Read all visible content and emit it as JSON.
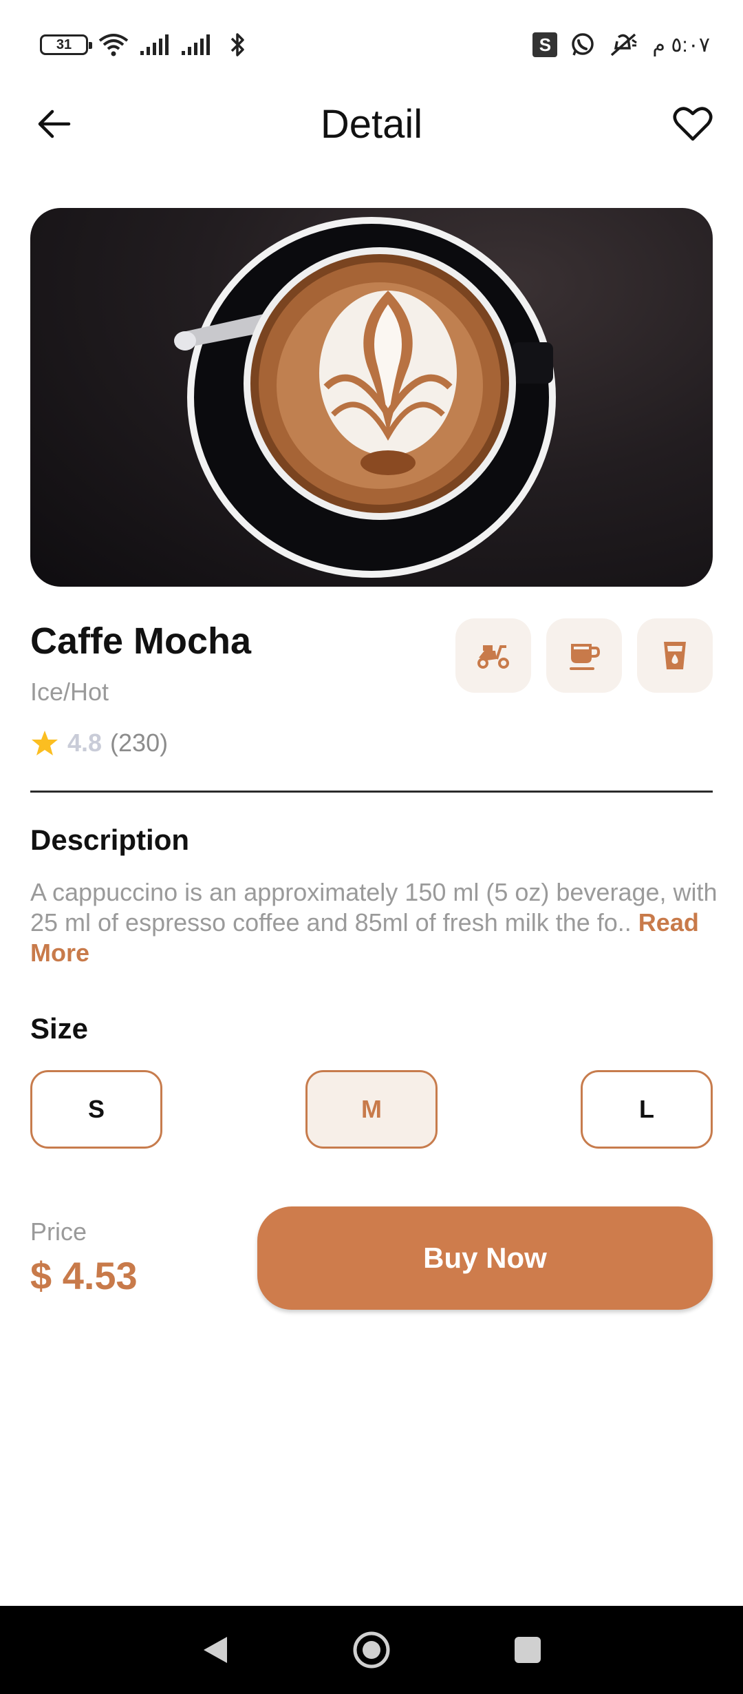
{
  "status_bar": {
    "battery_level": "31",
    "time": "٥:٠٧ م",
    "icons": [
      "wifi-icon",
      "signal-icon",
      "signal-icon",
      "bluetooth-icon",
      "s-app-icon",
      "whatsapp-icon",
      "muted-icon"
    ],
    "s_app_letter": "S"
  },
  "app_bar": {
    "title": "Detail",
    "back_icon": "arrow-left-icon",
    "favorite_icon": "heart-outline-icon"
  },
  "product": {
    "name": "Caffe Mocha",
    "subtitle": "Ice/Hot",
    "rating": "4.8",
    "reviews": "(230)",
    "features": [
      "delivery-scooter-icon",
      "coffee-cup-icon",
      "milk-glass-icon"
    ]
  },
  "description": {
    "title": "Description",
    "text": "A cappuccino is an approximately 150 ml (5 oz) beverage, with 25 ml of espresso coffee and 85ml of fresh milk the fo..",
    "read_more": "Read More"
  },
  "size": {
    "title": "Size",
    "options": [
      "S",
      "M",
      "L"
    ],
    "selected": "M"
  },
  "checkout": {
    "price_label": "Price",
    "price": "$ 4.53",
    "buy_label": "Buy Now"
  },
  "colors": {
    "accent": "#C87A4A",
    "button": "#CE7C4C",
    "chip_bg": "#F7F1EC",
    "star": "#FBBE21"
  }
}
